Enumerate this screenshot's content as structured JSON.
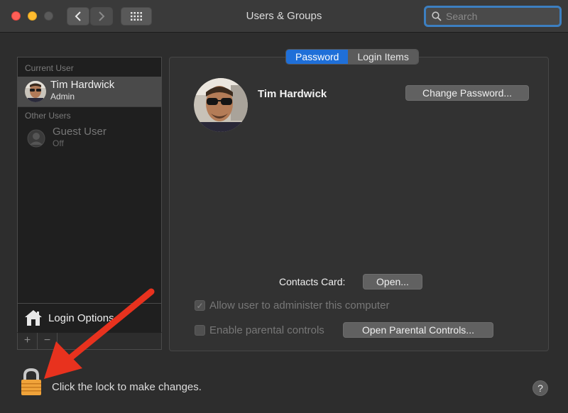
{
  "window": {
    "title": "Users & Groups"
  },
  "search": {
    "placeholder": "Search"
  },
  "sidebar": {
    "current_header": "Current User",
    "current_user": {
      "name": "Tim Hardwick",
      "role": "Admin"
    },
    "other_header": "Other Users",
    "guest_user": {
      "name": "Guest User",
      "status": "Off"
    },
    "login_options": "Login Options",
    "add_symbol": "+",
    "remove_symbol": "−"
  },
  "tabs": [
    {
      "label": "Password",
      "active": true
    },
    {
      "label": "Login Items",
      "active": false
    }
  ],
  "detail": {
    "name": "Tim Hardwick",
    "change_password": "Change Password...",
    "contacts_label": "Contacts Card:",
    "open_button": "Open...",
    "allow_admin": "Allow user to administer this computer",
    "allow_admin_checked": true,
    "parental": "Enable parental controls",
    "parental_checked": false,
    "open_parental": "Open Parental Controls..."
  },
  "footer": {
    "lock_text": "Click the lock to make changes.",
    "help": "?"
  },
  "colors": {
    "accent": "#1f6fd8",
    "arrow": "#e8321e",
    "lock": "#f0a33a"
  },
  "icons": [
    "close-icon",
    "minimize-icon",
    "zoom-icon",
    "chevron-left-icon",
    "chevron-right-icon",
    "grid-icon",
    "search-icon",
    "house-icon",
    "lock-icon",
    "help-icon"
  ]
}
